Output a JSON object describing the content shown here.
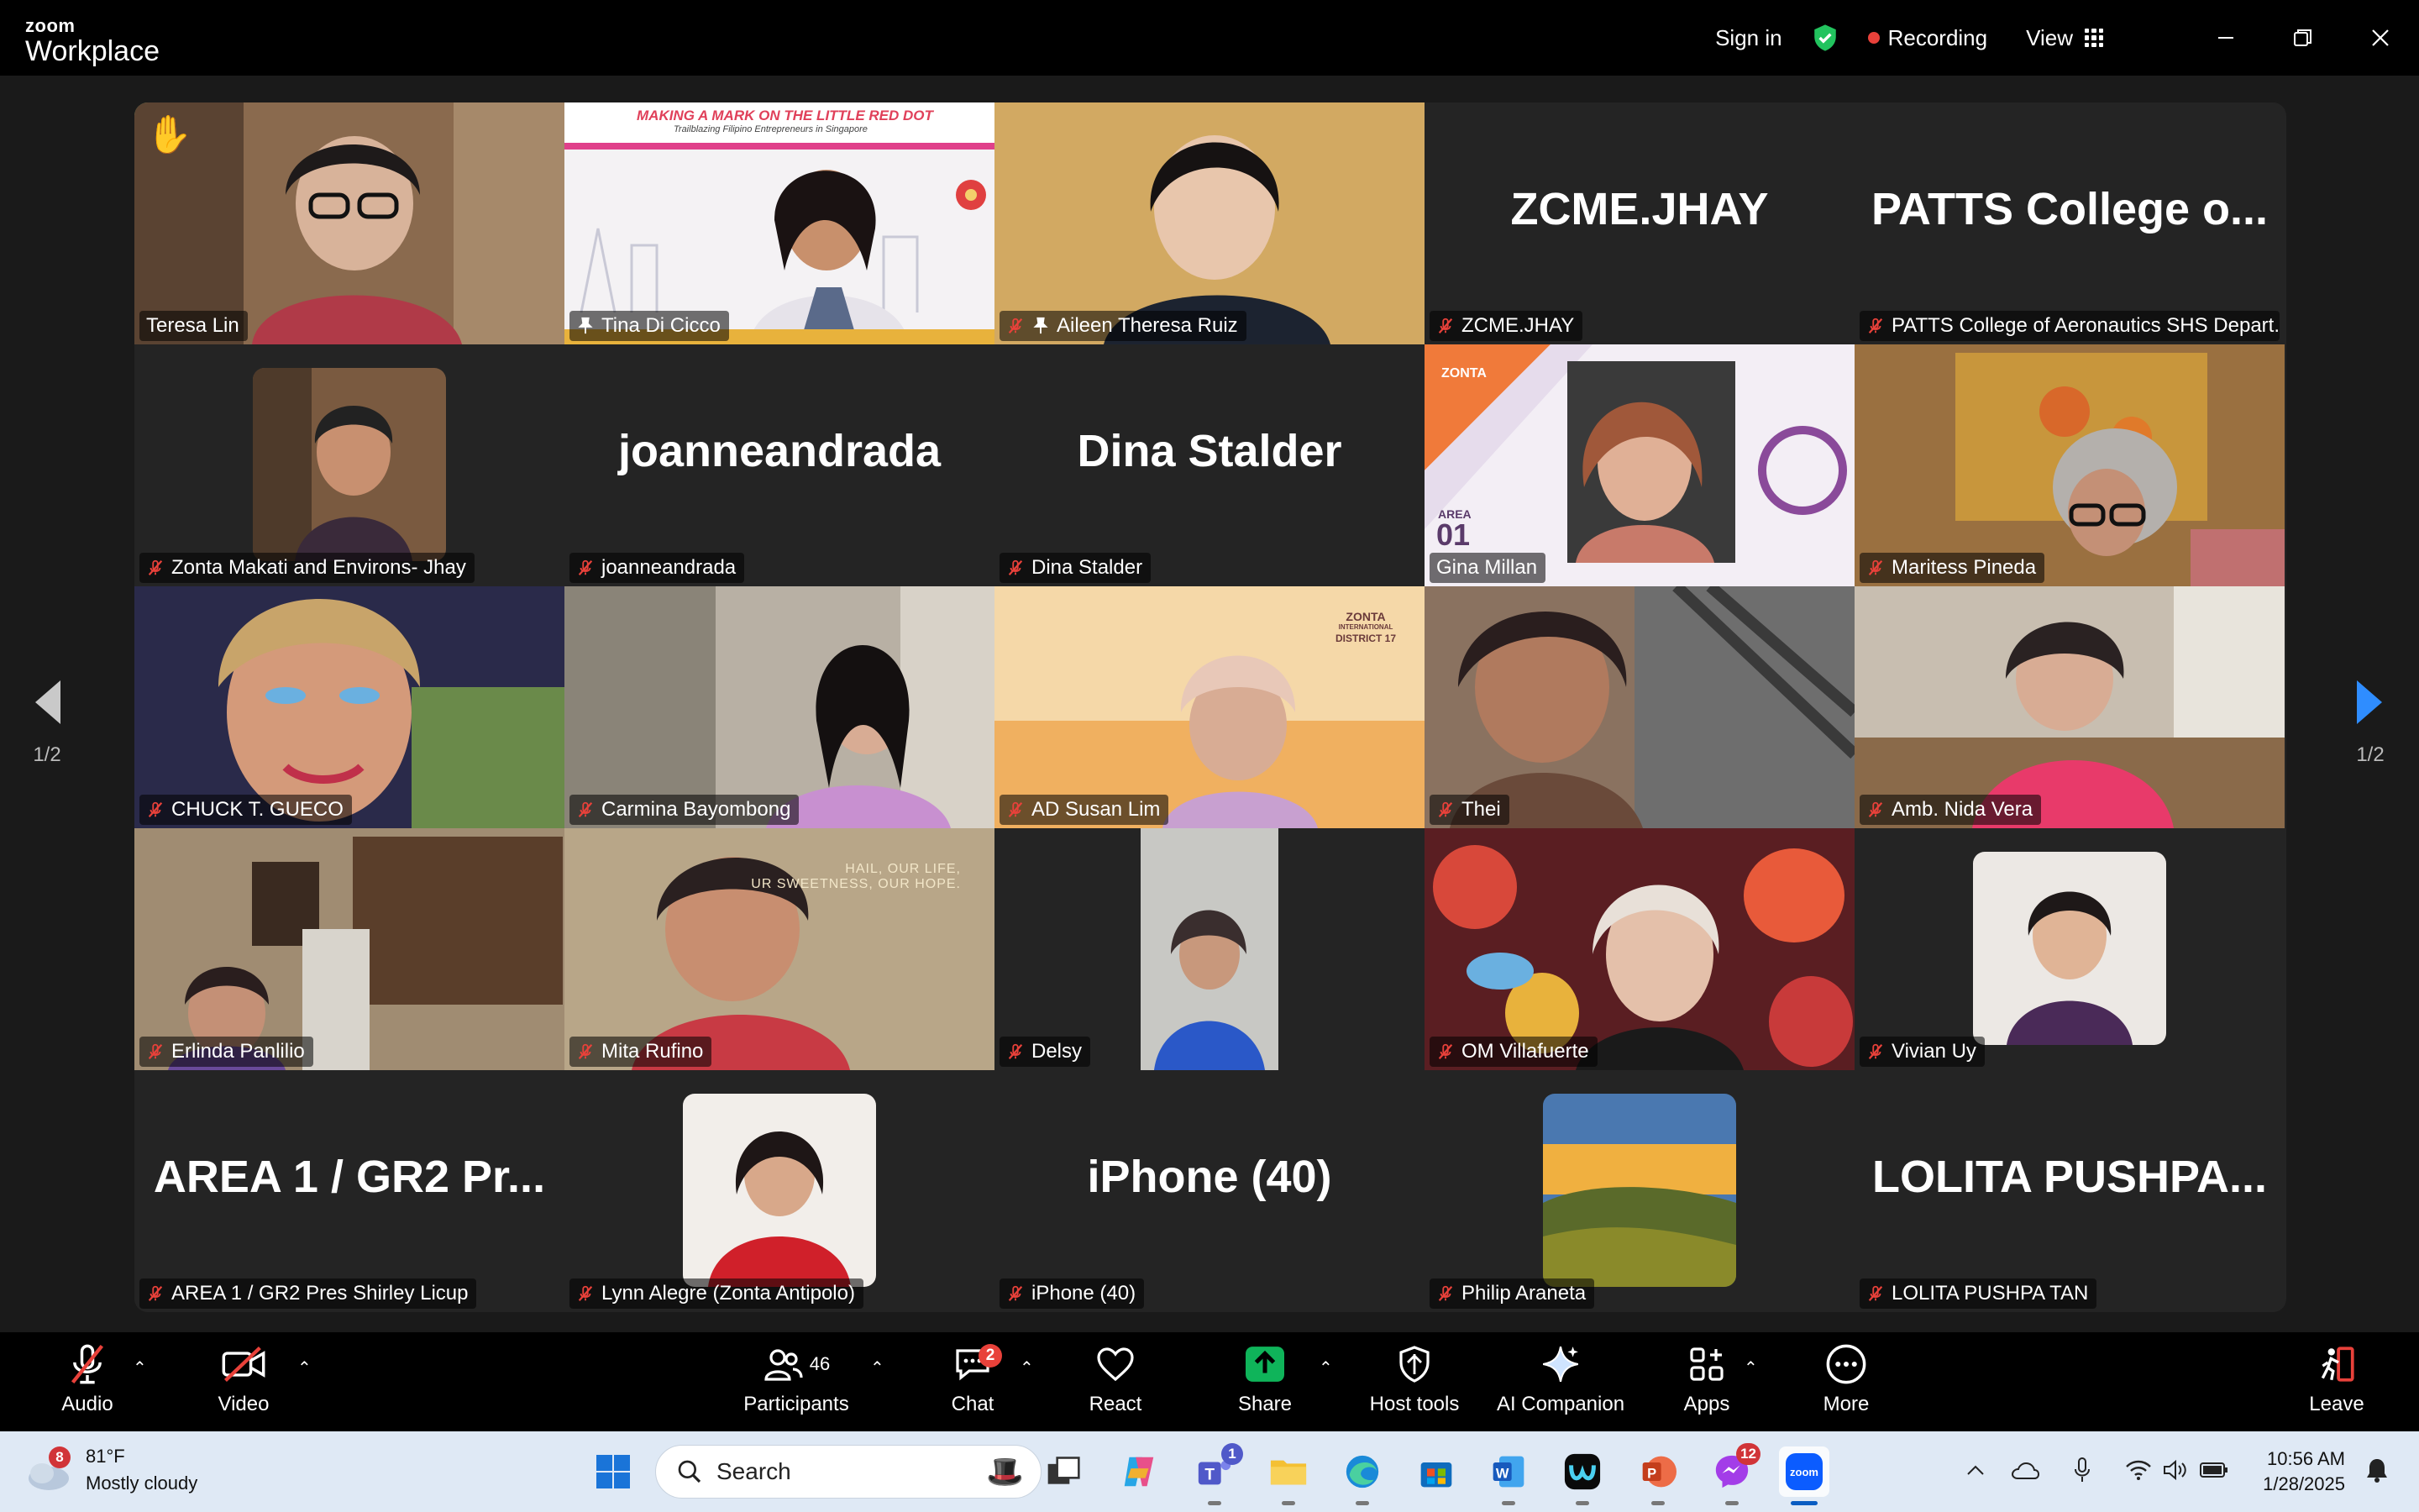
{
  "titlebar": {
    "brand_small": "zoom",
    "brand_big": "Workplace",
    "sign_in": "Sign in",
    "recording": "Recording",
    "view": "View"
  },
  "gallery": {
    "page_left": "1/2",
    "page_right": "1/2",
    "tiles": [
      {
        "name": "Teresa Lin"
      },
      {
        "name": "Tina Di Cicco",
        "banner": "MAKING A MARK ON THE LITTLE RED DOT",
        "banner_sub": "Trailblazing Filipino Entrepreneurs in Singapore"
      },
      {
        "name": "Aileen Theresa Ruiz"
      },
      {
        "name": "ZCME.JHAY",
        "big": "ZCME.JHAY"
      },
      {
        "name": "PATTS College of Aeronautics SHS Depart...",
        "big": "PATTS College o..."
      },
      {
        "name": "Zonta Makati and Environs- Jhay"
      },
      {
        "name": "joanneandrada",
        "big": "joanneandrada"
      },
      {
        "name": "Dina Stalder",
        "big": "Dina Stalder"
      },
      {
        "name": "Gina Millan",
        "area": "AREA",
        "area_num": "01",
        "zonta": "ZONTA"
      },
      {
        "name": "Maritess Pineda"
      },
      {
        "name": "CHUCK T. GUECO"
      },
      {
        "name": "Carmina Bayombong"
      },
      {
        "name": "AD Susan Lim",
        "logo": "ZONTA",
        "logo_sub": "INTERNATIONAL",
        "district": "DISTRICT 17"
      },
      {
        "name": "Thei"
      },
      {
        "name": "Amb. Nida Vera"
      },
      {
        "name": "Erlinda Panlilio"
      },
      {
        "name": "Mita Rufino",
        "bg_text1": "HAIL, OUR LIFE,",
        "bg_text2": "UR SWEETNESS, OUR HOPE."
      },
      {
        "name": "Delsy"
      },
      {
        "name": "OM Villafuerte"
      },
      {
        "name": "Vivian Uy"
      },
      {
        "name": "AREA 1 / GR2 Pres Shirley Licup",
        "big": "AREA 1 / GR2 Pr..."
      },
      {
        "name": "Lynn Alegre (Zonta Antipolo)"
      },
      {
        "name": "iPhone (40)",
        "big": "iPhone (40)"
      },
      {
        "name": "Philip Araneta"
      },
      {
        "name": "LOLITA PUSHPA TAN",
        "big": "LOLITA  PUSHPA..."
      }
    ]
  },
  "toolbar": {
    "audio": "Audio",
    "video": "Video",
    "participants": "Participants",
    "participants_count": "46",
    "chat": "Chat",
    "chat_badge": "2",
    "react": "React",
    "share": "Share",
    "host_tools": "Host tools",
    "ai_companion": "AI Companion",
    "apps": "Apps",
    "more": "More",
    "leave": "Leave"
  },
  "taskbar": {
    "weather_badge": "8",
    "temp": "81°F",
    "condition": "Mostly cloudy",
    "search": "Search",
    "teams_badge": "1",
    "messenger_badge": "12",
    "time": "10:56 AM",
    "date": "1/28/2025"
  }
}
